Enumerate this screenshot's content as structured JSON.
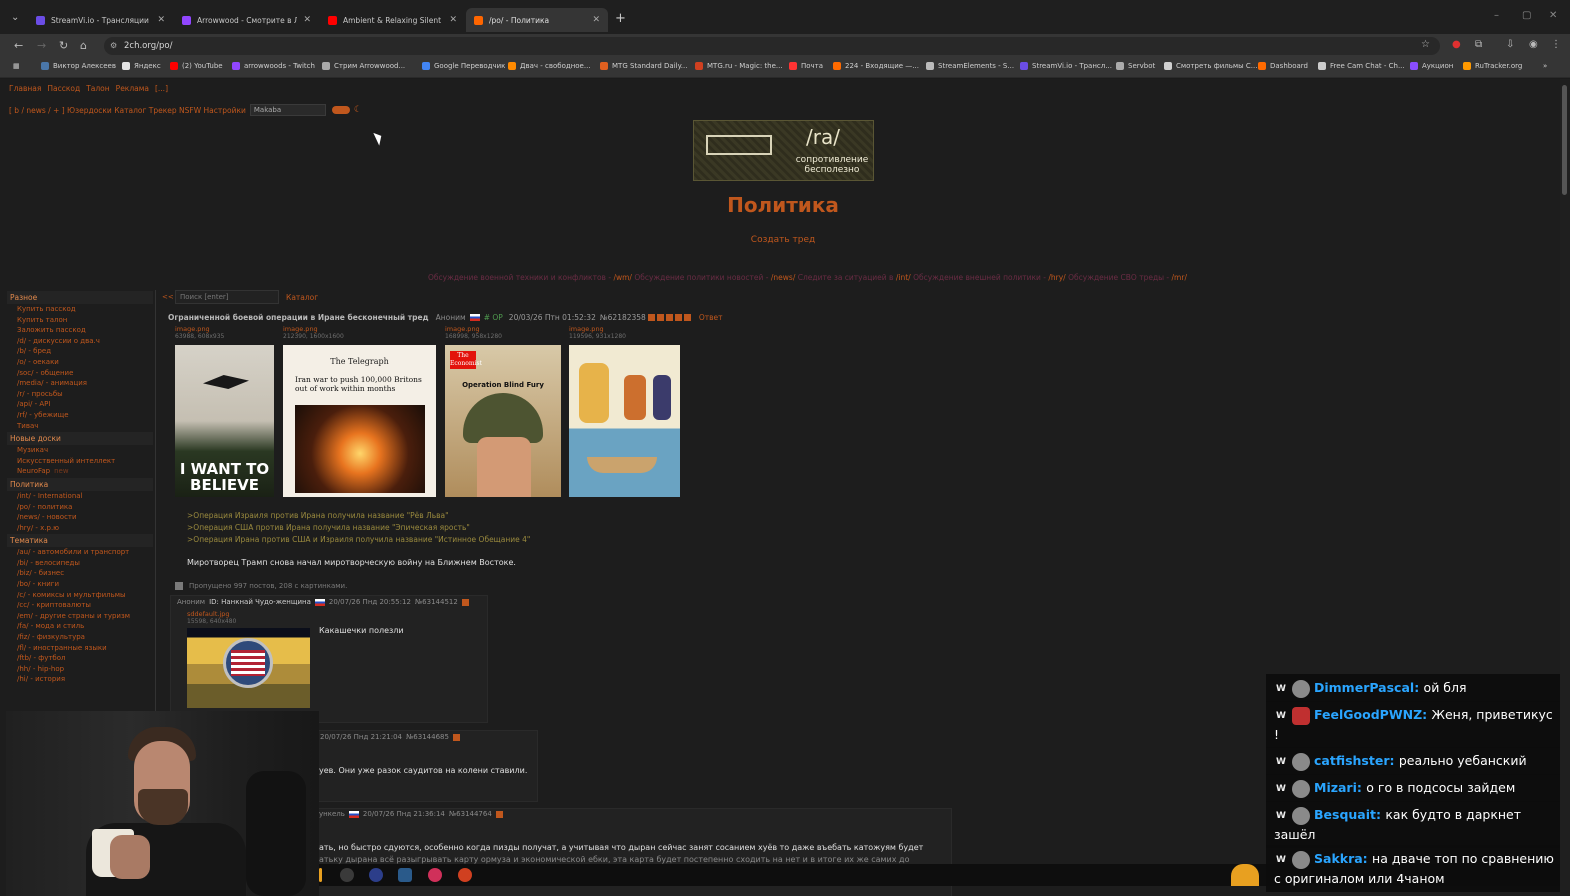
{
  "browser": {
    "tabs": [
      {
        "title": "StreamVi.io - Трансляции в нескольких",
        "color": "#6b4de6"
      },
      {
        "title": "Arrowwood - Смотрите в Лайв",
        "color": "#9146ff"
      },
      {
        "title": "Ambient & Relaxing Silent Hill",
        "color": "#ff0000"
      },
      {
        "title": "/po/ - Политика",
        "color": "#ff6600"
      }
    ],
    "new_tab_symbol": "+",
    "url": "2ch.org/po/",
    "bookmarks": [
      {
        "label": "Виктор Алексеев",
        "color": "#4a76a8"
      },
      {
        "label": "Яндекс",
        "color": "#e5e5e5"
      },
      {
        "label": "(2) YouTube",
        "color": "#ff0000"
      },
      {
        "label": "arrowwoods - Twitch",
        "color": "#9146ff"
      },
      {
        "label": "Стрим Arrowwood...",
        "color": "#aaaaaa"
      },
      {
        "label": "Google Переводчик",
        "color": "#4285f4"
      },
      {
        "label": "Двач - свободное...",
        "color": "#ff8a00"
      },
      {
        "label": "MTG Standard Daily...",
        "color": "#e06020"
      },
      {
        "label": "MTG.ru - Magic: the...",
        "color": "#d04020"
      },
      {
        "label": "Почта",
        "color": "#ff3333"
      },
      {
        "label": "224 - Входящие —...",
        "color": "#ff6a00"
      },
      {
        "label": "StreamElements - S...",
        "color": "#bbbbbb"
      },
      {
        "label": "StreamVi.io - Трансл...",
        "color": "#6b4de6"
      },
      {
        "label": "Servbot",
        "color": "#aaaaaa"
      },
      {
        "label": "Смотреть фильмы С...",
        "color": "#d0d0d0"
      },
      {
        "label": "Dashboard",
        "color": "#ff6a00"
      },
      {
        "label": "Free Cam Chat - Ch...",
        "color": "#cccccc"
      },
      {
        "label": "Аукцион",
        "color": "#8a4dff"
      },
      {
        "label": "RuTracker.org",
        "color": "#ff9900"
      }
    ]
  },
  "site": {
    "top_links": [
      "Главная",
      "Пасскод",
      "Талон",
      "Реклама",
      "[...]"
    ],
    "board_nav": "[ b / news / + ] Юзердоски Каталог Трекер NSFW Настройки",
    "style_select": "Makaba",
    "banner_tag": "/ra/",
    "banner_slogan": "сопротивление бесполезно",
    "board_title": "Политика",
    "create_thread": "Создать тред",
    "promo_parts": [
      {
        "text": "Обсуждение военной техники и конфликтов - ",
        "link": "/wm/"
      },
      {
        "text": " Обсуждение политики новостей - ",
        "link": "/news/"
      },
      {
        "text": " Следите за ситуацией в ",
        "link": "/int/"
      },
      {
        "text": " Обсуждение внешней политики - ",
        "link": "/hry/"
      },
      {
        "text": " Обсуждение СВО треды - ",
        "link": "/mr/"
      }
    ]
  },
  "sidebar": {
    "sections": [
      {
        "title": "Разное",
        "items": [
          "Купить пасскод",
          "Купить талон",
          "Заложить пасскод",
          "/d/ - дискуссии о два.ч",
          "/b/ - бред",
          "/o/ - оекаки",
          "/soc/ - общение",
          "/media/ - анимация",
          "/r/ - просьбы",
          "/api/ - API",
          "/rf/ - убежище",
          "Тивач"
        ]
      },
      {
        "title": "Новые доски",
        "items": [
          "Музикач",
          "Искусственный интеллект",
          "NeuroFap"
        ]
      },
      {
        "title": "Политика",
        "items": [
          "/int/ - International",
          "/po/ - политика",
          "/news/ - новости",
          "/hry/ - х.р.ю"
        ]
      },
      {
        "title": "Тематика",
        "items": [
          "/au/ - автомобили и транспорт",
          "/bi/ - велосипеды",
          "/biz/ - бизнес",
          "/bo/ - книги",
          "/c/ - комиксы и мультфильмы",
          "/cc/ - криптовалюты",
          "/em/ - другие страны и туризм",
          "/fa/ - мода и стиль",
          "/fiz/ - физкультура",
          "/fl/ - иностранные языки",
          "/ftb/ - футбол",
          "/hh/ - hip-hop",
          "/hi/ - история"
        ]
      }
    ],
    "new_badge": "new"
  },
  "thread": {
    "collapse": "<<",
    "search_placeholder": "Поиск [enter]",
    "catalog": "Каталог",
    "subject": "Ограниченной боевой операции в Иране бесконечный тред",
    "name": "Аноним",
    "op_label": "# OP",
    "date": "20/03/26 Птн 01:52:32",
    "num": "№62182358",
    "reply_label": "Ответ",
    "files": [
      {
        "name": "image.png",
        "meta": "63988, 608x935",
        "caption": "I WANT TO BELIEVE"
      },
      {
        "name": "image.png",
        "meta": "212390, 1600x1600",
        "masthead": "The Telegraph",
        "headline": "Iran war to push 100,000 Britons out of work within months"
      },
      {
        "name": "image.png",
        "meta": "168998, 958x1280",
        "logo": "The Economist",
        "cover": "Operation Blind Fury"
      },
      {
        "name": "image.png",
        "meta": "119596, 931x1280"
      }
    ],
    "greentext": [
      ">Операция Израиля против Ирана получила название \"Рёв Льва\"",
      ">Операция США против Ирана получила название \"Эпическая ярость\"",
      ">Операция Ирана против США и Израиля получила название \"Истинное Обещание 4\""
    ],
    "op_text": "Миротворец Трамп снова начал миротворческую войну на Ближнем Востоке.",
    "omitted": "Пропущено 997 постов, 208 с картинками.",
    "replies": [
      {
        "name": "Аноним",
        "id": "ID: Нанкнай Чудо-женщина",
        "date": "20/07/26 Пнд 20:55:12",
        "num": "№63144512",
        "file": "sddefault.jpg",
        "file_meta": "15598, 640x480",
        "text": "Какашечки полезли"
      },
      {
        "date": "20/07/26 Пнд 21:21:04",
        "num": "№63144685",
        "text": "уев. Они уже разок саудитов на колени ставили."
      },
      {
        "name_fragment": "ункель",
        "date": "20/07/26 Пнд 21:36:14",
        "num": "№63144764",
        "text": "ать, но быстро сдуются, особенно когда пизды получат, а учитывая что дыран сейчас занят сосанием хуёв то даже въебать катожуям будет",
        "text2": "атьку дырана всё разыгрывать карту ормуза и экономической ебки, эта карта будет постепенно сходить на нет и в итоге их же самих до"
      }
    ]
  },
  "chat": [
    {
      "user": "DimmerPascal",
      "msg": "ой бля"
    },
    {
      "user": "FeelGoodPWNZ",
      "msg": "Женя, приветикус !"
    },
    {
      "user": "catfishster",
      "msg": "реально уебанский"
    },
    {
      "user": "Mizari",
      "msg": "о го в подсосы зайдем"
    },
    {
      "user": "Besquait",
      "msg": "как будто в даркнет зашёл"
    },
    {
      "user": "Sakkra",
      "msg": "на дваче топ по сравнению с оригиналом или 4чаном"
    }
  ],
  "colors": {
    "accent": "#c0571d",
    "chat_user": "#2aa5ff"
  }
}
